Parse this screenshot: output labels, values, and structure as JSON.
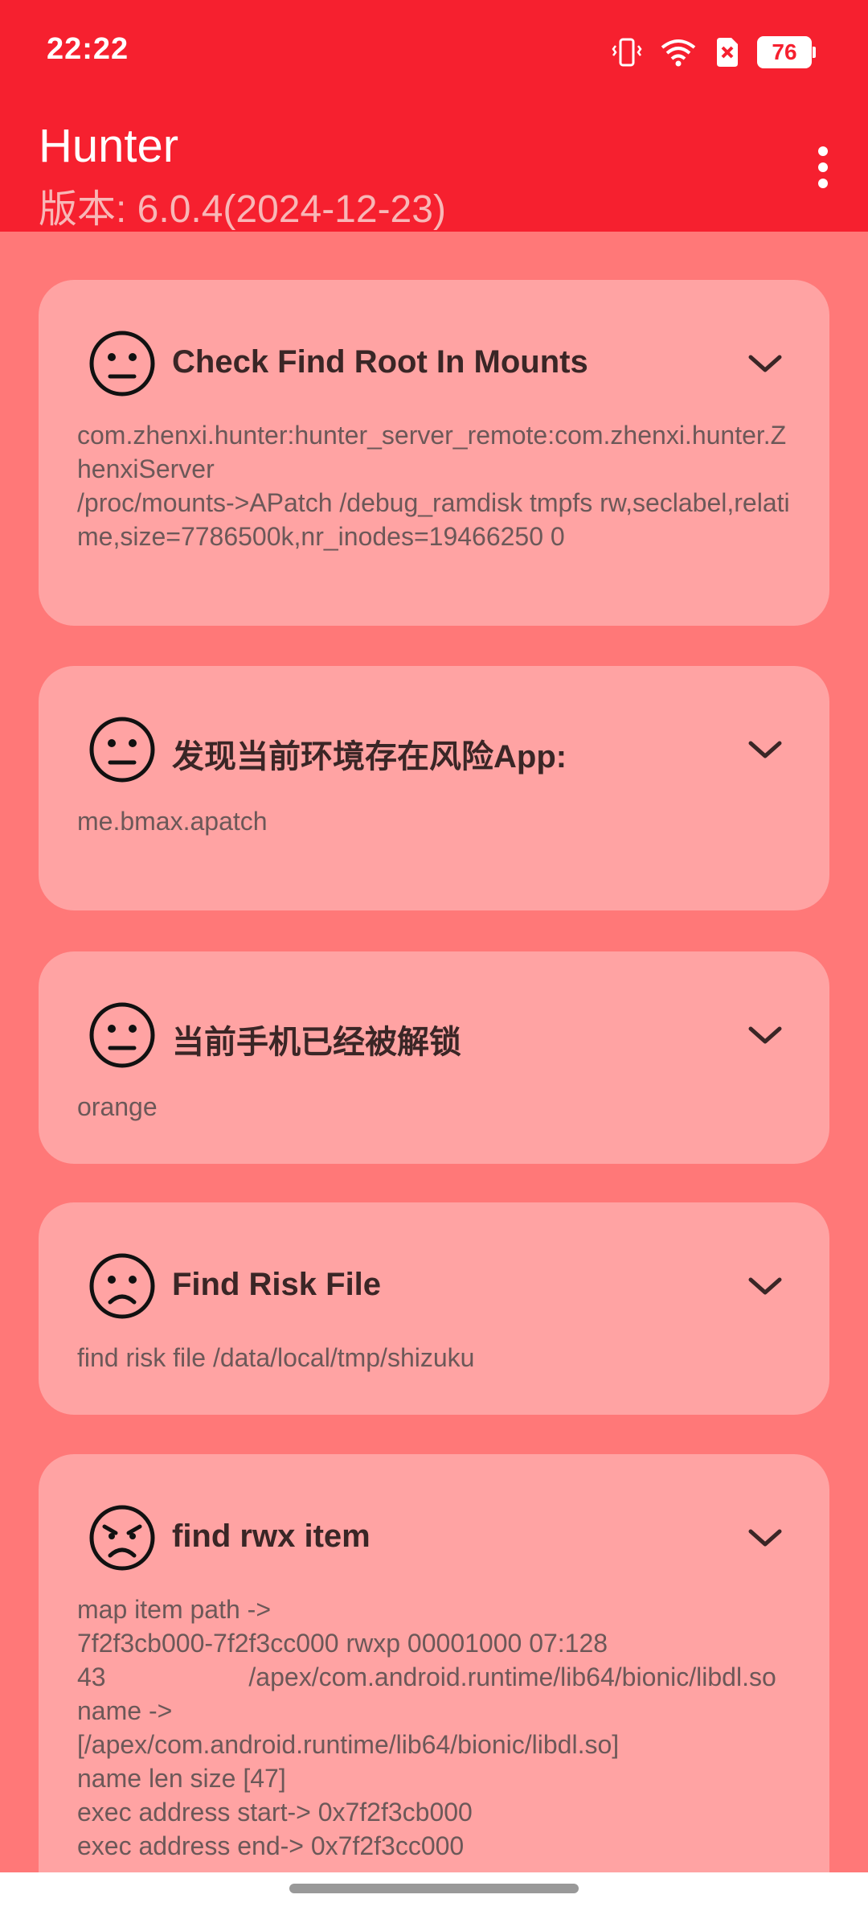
{
  "status_bar": {
    "time": "22:22",
    "battery": "76"
  },
  "app_bar": {
    "title": "Hunter",
    "subtitle": "版本: 6.0.4(2024-12-23)"
  },
  "cards": [
    {
      "title": "Check Find Root In Mounts",
      "icon": "neutral-face-icon",
      "body": "com.zhenxi.hunter:hunter_server_remote:com.zhenxi.hunter.ZhenxiServer\n/proc/mounts->APatch /debug_ramdisk tmpfs rw,seclabel,relatime,size=7786500k,nr_inodes=19466250 0"
    },
    {
      "title": "发现当前环境存在风险App:",
      "icon": "neutral-face-icon",
      "body": "me.bmax.apatch"
    },
    {
      "title": "当前手机已经被解锁",
      "icon": "neutral-face-icon",
      "body": "orange"
    },
    {
      "title": "Find Risk File",
      "icon": "sad-face-icon",
      "body": "find risk file /data/local/tmp/shizuku"
    },
    {
      "title": "find rwx item",
      "icon": "angry-face-icon",
      "body": "map item path ->\n7f2f3cb000-7f2f3cc000 rwxp 00001000 07:128\n43                    /apex/com.android.runtime/lib64/bionic/libdl.so\nname ->\n[/apex/com.android.runtime/lib64/bionic/libdl.so]\nname len size [47]\nexec address start-> 0x7f2f3cb000\nexec address end-> 0x7f2f3cc000"
    }
  ]
}
